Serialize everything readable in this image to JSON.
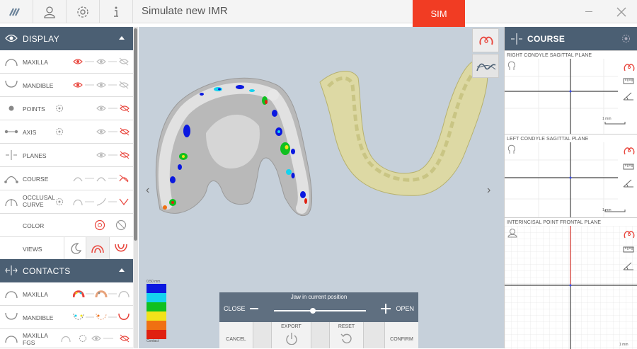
{
  "window": {
    "title": "Simulate new IMR",
    "sim_button": "SIM"
  },
  "display": {
    "header": "DISPLAY",
    "rows": [
      {
        "label": "MAXILLA"
      },
      {
        "label": "MANDIBLE"
      },
      {
        "label": "POINTS"
      },
      {
        "label": "AXIS"
      },
      {
        "label": "PLANES"
      },
      {
        "label": "COURSE"
      },
      {
        "label_line1": "OCCLUSAL",
        "label_line2": "CURVE"
      },
      {
        "label": "COLOR"
      },
      {
        "label": "VIEWS"
      }
    ]
  },
  "contacts": {
    "header": "CONTACTS",
    "rows": [
      {
        "label": "MAXILLA"
      },
      {
        "label": "MANDIBLE"
      },
      {
        "label_line1": "MAXILLA",
        "label_line2": "FGS"
      }
    ]
  },
  "legend": {
    "top_label": "0.50 mm",
    "bottom_label": "Contact",
    "colors": [
      "#0a18e0",
      "#14d2ee",
      "#10c020",
      "#f2e21a",
      "#f07012",
      "#e02010"
    ]
  },
  "jaw_control": {
    "caption": "Jaw in current position",
    "close_label": "CLOSE",
    "open_label": "OPEN",
    "slider_value": 0.42,
    "buttons": {
      "cancel": "CANCEL",
      "export": "EXPORT",
      "reset": "RESET",
      "confirm": "CONFIRM"
    }
  },
  "course": {
    "header": "COURSE",
    "planes": [
      {
        "title": "RIGHT CONDYLE SAGITTAL PLANE",
        "scale": "1 mm"
      },
      {
        "title": "LEFT CONDYLE SAGITTAL PLANE",
        "scale": "1 mm"
      },
      {
        "title": "INTERINCISAL POINT FRONTAL PLANE",
        "scale": "1 mm"
      }
    ]
  },
  "colors": {
    "accent": "#f13c23",
    "panel_header": "#4b5f73",
    "viewport": "#c6d0da",
    "active_icon": "#e8453c"
  }
}
